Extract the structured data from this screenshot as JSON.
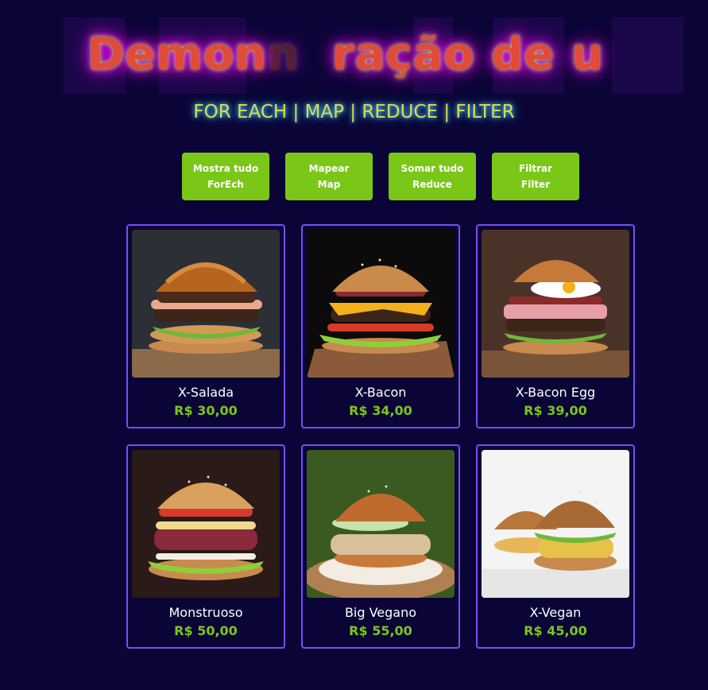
{
  "header": {
    "title_visible": "Demon",
    "title_fragment_1": "n",
    "title_fragment_2": "ração de u",
    "subtitle": "FOR EACH | MAP | REDUCE | FILTER"
  },
  "buttons": [
    {
      "line1": "Mostra tudo",
      "line2": "ForEch"
    },
    {
      "line1": "Mapear",
      "line2": "Map"
    },
    {
      "line1": "Somar tudo",
      "line2": "Reduce"
    },
    {
      "line1": "Filtrar",
      "line2": "Filter"
    }
  ],
  "products": [
    {
      "name": "X-Salada",
      "price": "R$ 30,00"
    },
    {
      "name": "X-Bacon",
      "price": "R$ 34,00"
    },
    {
      "name": "X-Bacon Egg",
      "price": "R$ 39,00"
    },
    {
      "name": "Monstruoso",
      "price": "R$ 50,00"
    },
    {
      "name": "Big Vegano",
      "price": "R$ 55,00"
    },
    {
      "name": "X-Vegan",
      "price": "R$ 45,00"
    }
  ],
  "colors": {
    "background": "#0a0536",
    "accent_green": "#7ac717",
    "card_border": "#7c4cf2",
    "title_red": "#e24a3a",
    "subtitle_yellow": "#e8d64a"
  }
}
